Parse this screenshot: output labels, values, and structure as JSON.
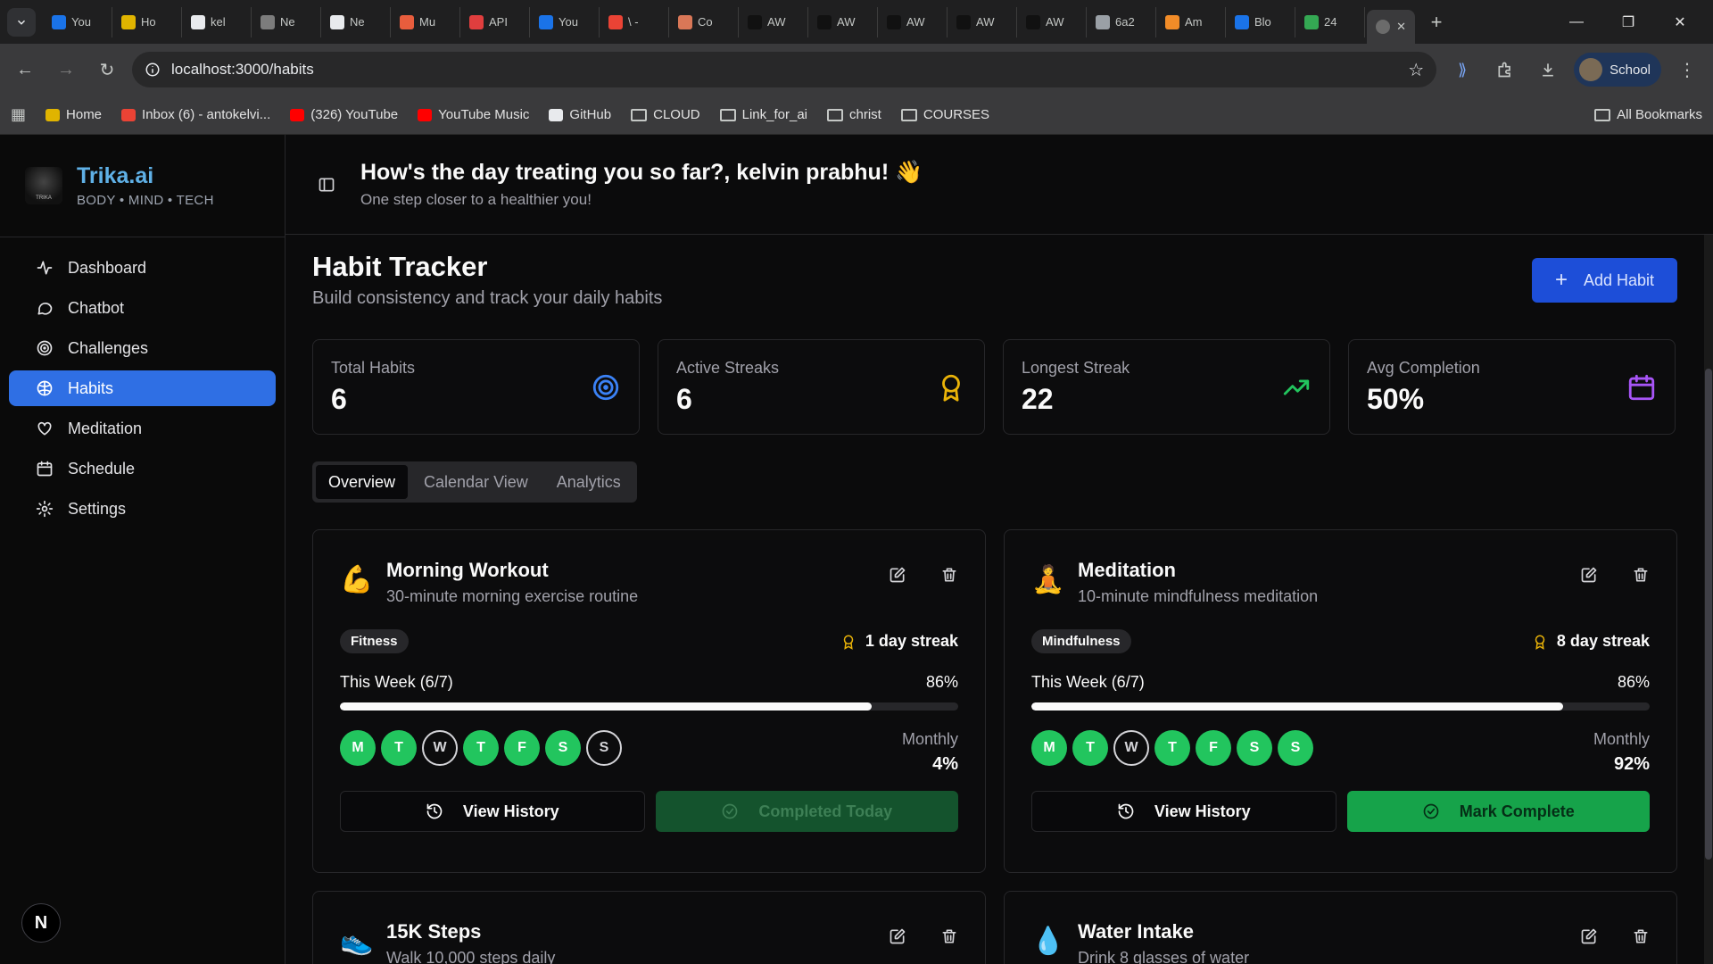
{
  "browser": {
    "tabs": [
      {
        "label": "You",
        "color": "#1a73e8"
      },
      {
        "label": "Ho",
        "color": "#e0b400"
      },
      {
        "label": "kel",
        "color": "#e8eaed"
      },
      {
        "label": "Ne",
        "color": "#7c7c7c"
      },
      {
        "label": "Ne",
        "color": "#e8eaed"
      },
      {
        "label": "Mu",
        "color": "#e85d3d"
      },
      {
        "label": "API",
        "color": "#e03e3e"
      },
      {
        "label": "You",
        "color": "#1a73e8"
      },
      {
        "label": "\\ - ",
        "color": "#ea4335"
      },
      {
        "label": "Co",
        "color": "#d97757"
      },
      {
        "label": "AW",
        "color": "#111111"
      },
      {
        "label": "AW",
        "color": "#111111"
      },
      {
        "label": "AW",
        "color": "#111111"
      },
      {
        "label": "AW",
        "color": "#111111"
      },
      {
        "label": "AW",
        "color": "#111111"
      },
      {
        "label": "6a2",
        "color": "#9aa0a6"
      },
      {
        "label": "Am",
        "color": "#f28c28"
      },
      {
        "label": "Blo",
        "color": "#1a73e8"
      },
      {
        "label": "24",
        "color": "#34a853"
      }
    ],
    "active_tab_close": "✕",
    "url": "localhost:3000/habits",
    "profile": "School",
    "bookmarks": [
      {
        "label": "Home",
        "type": "fav",
        "color": "#e0b400"
      },
      {
        "label": "Inbox (6) - antokelvi...",
        "type": "fav",
        "color": "#ea4335"
      },
      {
        "label": "(326) YouTube",
        "type": "fav",
        "color": "#ff0000"
      },
      {
        "label": "YouTube Music",
        "type": "fav",
        "color": "#ff0000"
      },
      {
        "label": "GitHub",
        "type": "fav",
        "color": "#e8eaed"
      },
      {
        "label": "CLOUD",
        "type": "folder"
      },
      {
        "label": "Link_for_ai",
        "type": "folder"
      },
      {
        "label": "christ",
        "type": "folder"
      },
      {
        "label": "COURSES",
        "type": "folder"
      }
    ],
    "all_bookmarks": "All Bookmarks"
  },
  "sidebar": {
    "brand": "Trika.ai",
    "tagline": "BODY • MIND • TECH",
    "logo_text": "TRIKA",
    "items": [
      {
        "label": "Dashboard",
        "icon": "activity-icon"
      },
      {
        "label": "Chatbot",
        "icon": "message-icon"
      },
      {
        "label": "Challenges",
        "icon": "target-icon"
      },
      {
        "label": "Habits",
        "icon": "habits-icon",
        "active": true
      },
      {
        "label": "Meditation",
        "icon": "heart-icon"
      },
      {
        "label": "Schedule",
        "icon": "calendar-icon"
      },
      {
        "label": "Settings",
        "icon": "gear-icon"
      }
    ],
    "badge": "N"
  },
  "header": {
    "greeting": "How's the day treating you so far?, kelvin prabhu! 👋",
    "subtitle": "One step closer to a healthier you!"
  },
  "page": {
    "title": "Habit Tracker",
    "subtitle": "Build consistency and track your daily habits",
    "add_button": "Add Habit"
  },
  "stats": [
    {
      "label": "Total Habits",
      "value": "6",
      "icon": "target-icon",
      "color": "#3b82f6"
    },
    {
      "label": "Active Streaks",
      "value": "6",
      "icon": "award-icon",
      "color": "#eab308"
    },
    {
      "label": "Longest Streak",
      "value": "22",
      "icon": "trending-up-icon",
      "color": "#22c55e"
    },
    {
      "label": "Avg Completion",
      "value": "50%",
      "icon": "calendar-icon",
      "color": "#a855f7"
    }
  ],
  "tabs": [
    {
      "label": "Overview",
      "active": true
    },
    {
      "label": "Calendar View"
    },
    {
      "label": "Analytics"
    }
  ],
  "habits": [
    {
      "emoji": "💪",
      "title": "Morning Workout",
      "description": "30-minute morning exercise routine",
      "category": "Fitness",
      "streak": "1 day streak",
      "week_label": "This Week (6/7)",
      "week_percent": "86%",
      "progress": 0.86,
      "days": [
        {
          "d": "M",
          "done": true
        },
        {
          "d": "T",
          "done": true
        },
        {
          "d": "W",
          "done": false
        },
        {
          "d": "T",
          "done": true
        },
        {
          "d": "F",
          "done": true
        },
        {
          "d": "S",
          "done": true
        },
        {
          "d": "S",
          "done": false
        }
      ],
      "monthly_label": "Monthly",
      "monthly_value": "4%",
      "history_label": "View History",
      "action_label": "Completed Today",
      "action_state": "done"
    },
    {
      "emoji": "🧘",
      "title": "Meditation",
      "description": "10-minute mindfulness meditation",
      "category": "Mindfulness",
      "streak": "8 day streak",
      "week_label": "This Week (6/7)",
      "week_percent": "86%",
      "progress": 0.86,
      "days": [
        {
          "d": "M",
          "done": true
        },
        {
          "d": "T",
          "done": true
        },
        {
          "d": "W",
          "done": false
        },
        {
          "d": "T",
          "done": true
        },
        {
          "d": "F",
          "done": true
        },
        {
          "d": "S",
          "done": true
        },
        {
          "d": "S",
          "done": true
        }
      ],
      "monthly_label": "Monthly",
      "monthly_value": "92%",
      "history_label": "View History",
      "action_label": "Mark Complete",
      "action_state": "pending"
    },
    {
      "emoji": "👟",
      "title": "15K Steps",
      "description": "Walk 10,000 steps daily"
    },
    {
      "emoji": "💧",
      "title": "Water Intake",
      "description": "Drink 8 glasses of water"
    }
  ]
}
